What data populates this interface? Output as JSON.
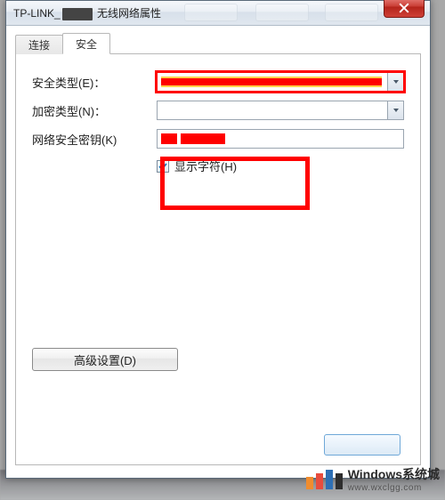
{
  "window": {
    "title_prefix": "TP-LINK_",
    "title_suffix": " 无线网络属性"
  },
  "tabs": {
    "connect": "连接",
    "security": "安全"
  },
  "form": {
    "security_type_label": "安全类型(E)：",
    "encryption_type_label": "加密类型(N)：",
    "network_key_label": "网络安全密钥(K)",
    "show_chars_label": "显示字符(H)"
  },
  "buttons": {
    "advanced": "高级设置(D)"
  },
  "watermark": {
    "brand": "Windows系统城",
    "url": "www.wxclgg.com"
  },
  "colors": {
    "highlight_red": "#f00",
    "close_red": "#c83b32"
  }
}
